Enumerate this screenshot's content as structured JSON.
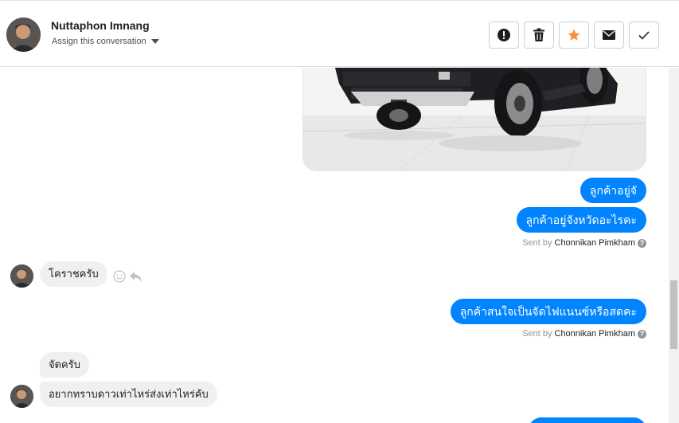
{
  "header": {
    "contact_name": "Nuttaphon Imnang",
    "assign_label": "Assign this conversation"
  },
  "actions": [
    {
      "name": "spam",
      "icon": "alert-circle-icon"
    },
    {
      "name": "delete",
      "icon": "trash-icon"
    },
    {
      "name": "star",
      "icon": "star-icon",
      "color": "#f7923b"
    },
    {
      "name": "mark-unread",
      "icon": "envelope-icon"
    },
    {
      "name": "done",
      "icon": "check-icon"
    }
  ],
  "messages": {
    "out_1": "ลูกค้าอยู่จั",
    "out_2": "ลูกค้าอยู่จังหวัดอะไรคะ",
    "sent_by_1": {
      "prefix": "Sent by",
      "name": "Chonnikan Pimkham"
    },
    "in_1": "โคราชครับ",
    "out_3": "ลูกค้าสนใจเป็นจัดไฟแนนซ์หรือสดคะ",
    "sent_by_2": {
      "prefix": "Sent by",
      "name": "Chonnikan Pimkham"
    },
    "in_2": "จัดครับ",
    "in_3": "อยากทราบดาวเท่าไหร่ส่งเท่าไหร่คับ"
  },
  "colors": {
    "outgoing_bubble": "#0084ff",
    "incoming_bubble": "#f1f0f0",
    "star": "#f7923b"
  }
}
